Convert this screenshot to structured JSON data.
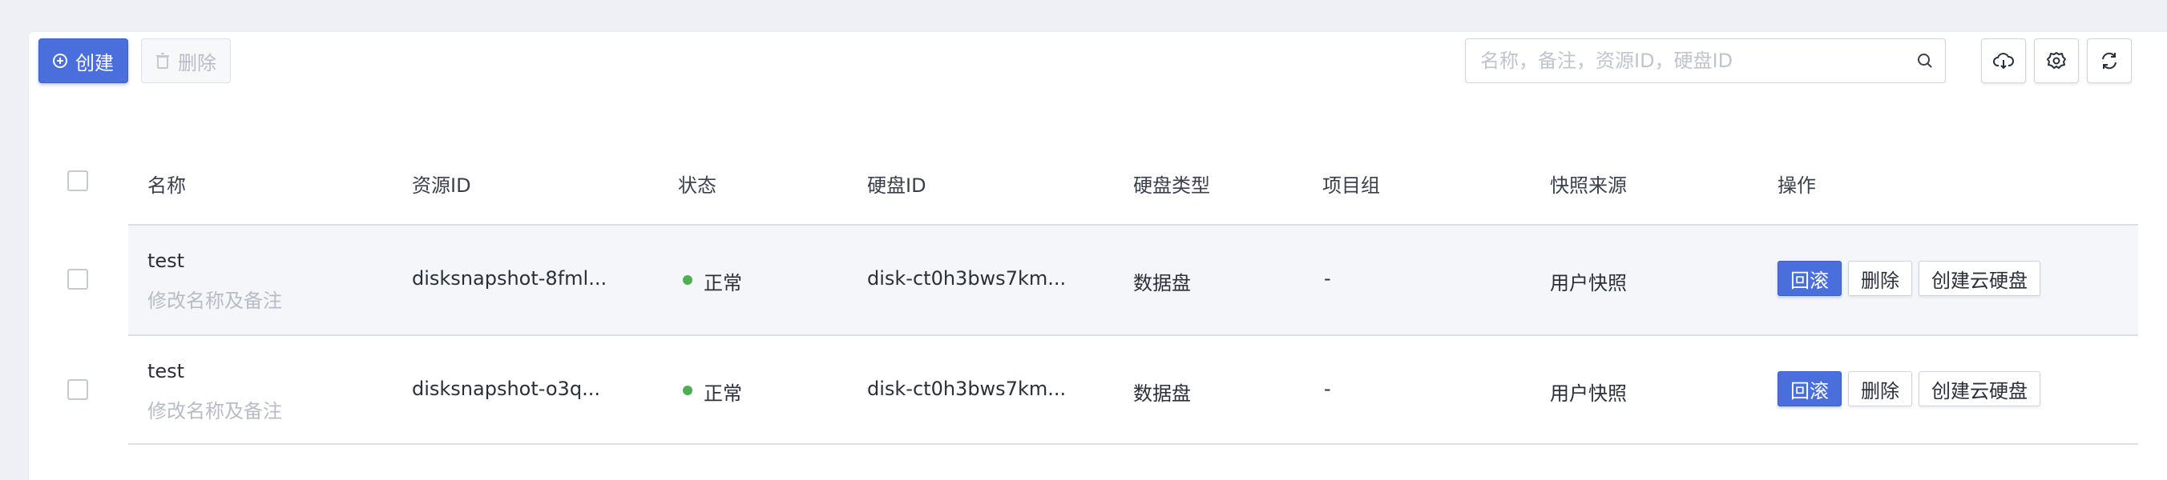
{
  "toolbar": {
    "create_label": "创建",
    "delete_label": "删除",
    "search_placeholder": "名称，备注，资源ID，硬盘ID",
    "icons": [
      "plus-circle-icon",
      "trash-icon",
      "search-icon",
      "cloud-download-icon",
      "gear-icon",
      "refresh-icon"
    ]
  },
  "table": {
    "headers": [
      "名称",
      "资源ID",
      "状态",
      "硬盘ID",
      "硬盘类型",
      "项目组",
      "快照来源",
      "操作"
    ],
    "rows": [
      {
        "name": "test",
        "edit_hint": "修改名称及备注",
        "resource_id": "disksnapshot-8fml...",
        "status": "正常",
        "disk_id": "disk-ct0h3bws7km...",
        "disk_type": "数据盘",
        "project": "-",
        "source": "用户快照",
        "actions": [
          "回滚",
          "删除",
          "创建云硬盘"
        ]
      },
      {
        "name": "test",
        "edit_hint": "修改名称及备注",
        "resource_id": "disksnapshot-o3q...",
        "status": "正常",
        "disk_id": "disk-ct0h3bws7km...",
        "disk_type": "数据盘",
        "project": "-",
        "source": "用户快照",
        "actions": [
          "回滚",
          "删除",
          "创建云硬盘"
        ]
      }
    ]
  },
  "colors": {
    "accent": "#4a6fdc",
    "status_ok": "#4caf50",
    "background": "#eef0f5"
  }
}
